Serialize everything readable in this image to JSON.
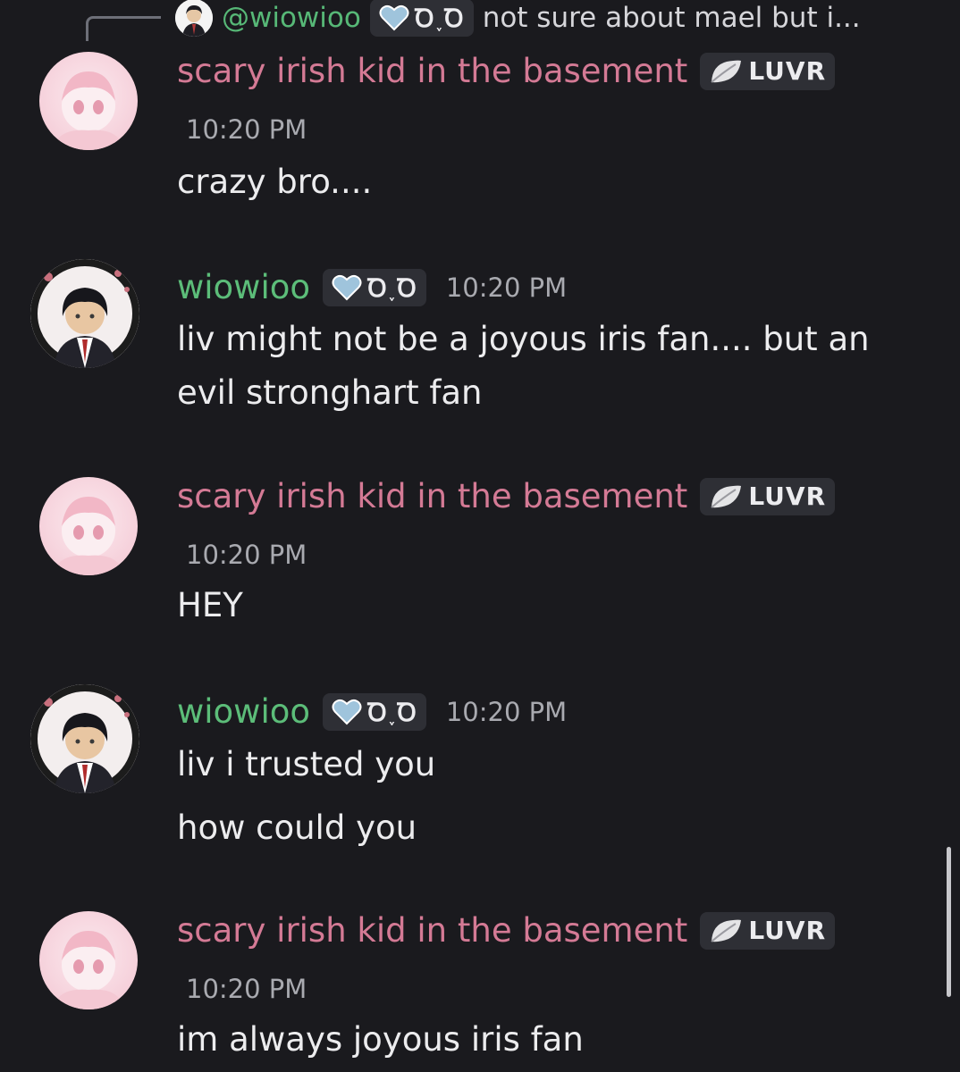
{
  "reply": {
    "username": "@wiowioo",
    "tag_text": "Ꝺ˯Ꝺ",
    "preview": "not sure about mael but i..."
  },
  "messages": [
    {
      "author": "scary irish kid in the basement",
      "author_color": "#d47a95",
      "tag": "LUVR",
      "time": "10:20 PM",
      "lines": [
        "crazy bro...."
      ]
    },
    {
      "author": "wiowioo",
      "author_color": "#5cbd79",
      "tag": "Ꝺ˯Ꝺ",
      "time": "10:20 PM",
      "lines": [
        "liv might not be a joyous iris fan.... but an evil stronghart fan"
      ]
    },
    {
      "author": "scary irish kid in the basement",
      "author_color": "#d47a95",
      "tag": "LUVR",
      "time": "10:20 PM",
      "lines": [
        "HEY"
      ]
    },
    {
      "author": "wiowioo",
      "author_color": "#5cbd79",
      "tag": "Ꝺ˯Ꝺ",
      "time": "10:20 PM",
      "lines": [
        "liv i trusted you",
        "how could you"
      ]
    },
    {
      "author": "scary irish kid in the basement",
      "author_color": "#d47a95",
      "tag": "LUVR",
      "time": "10:20 PM",
      "lines": [
        "im always joyous iris fan"
      ]
    }
  ],
  "icons": {
    "luvr_tag": "leaf-icon",
    "wiowioo_tag": "heart-icon"
  }
}
